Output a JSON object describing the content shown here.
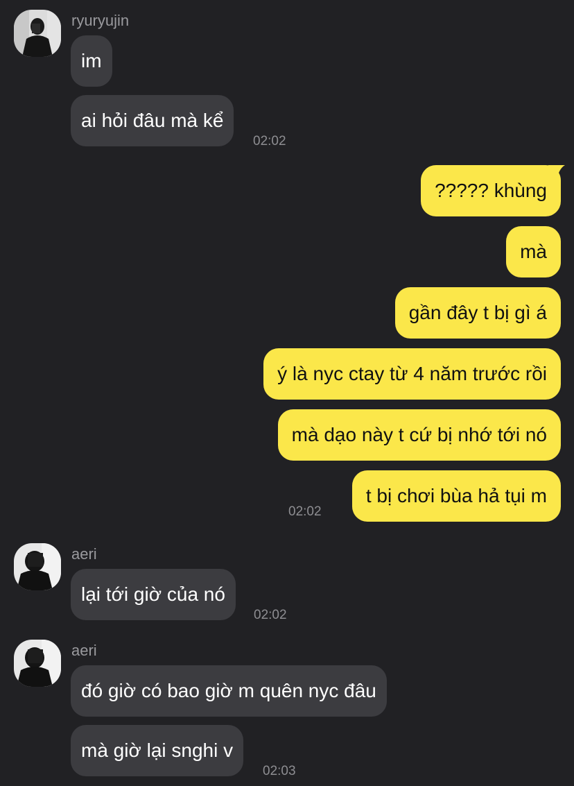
{
  "conversation": {
    "groups": [
      {
        "sender": "ryuryujin",
        "messages": [
          "im",
          "ai hỏi đâu mà kể"
        ],
        "time": "02:02"
      },
      {
        "sender": "me",
        "messages": [
          "????? khùng",
          "mà",
          "gần đây t bị gì á",
          "ý là nyc ctay từ 4 năm trước rồi",
          "mà dạo này t cứ bị nhớ tới nó",
          "t bị chơi bùa hả tụi m"
        ],
        "time": "02:02"
      },
      {
        "sender": "aeri",
        "messages": [
          "lại tới giờ của nó"
        ],
        "time": "02:02"
      },
      {
        "sender": "aeri",
        "messages": [
          "đó giờ có bao giờ m quên nyc đâu",
          "mà giờ lại snghi v"
        ],
        "time": "02:03"
      }
    ]
  },
  "colors": {
    "background": "#212124",
    "incoming_bubble": "#3c3c40",
    "outgoing_bubble": "#fbe74a",
    "timestamp": "#8e8e92",
    "sender_name": "#9a9a9e"
  },
  "icons": [
    "avatar-ryuryujin",
    "avatar-aeri"
  ]
}
